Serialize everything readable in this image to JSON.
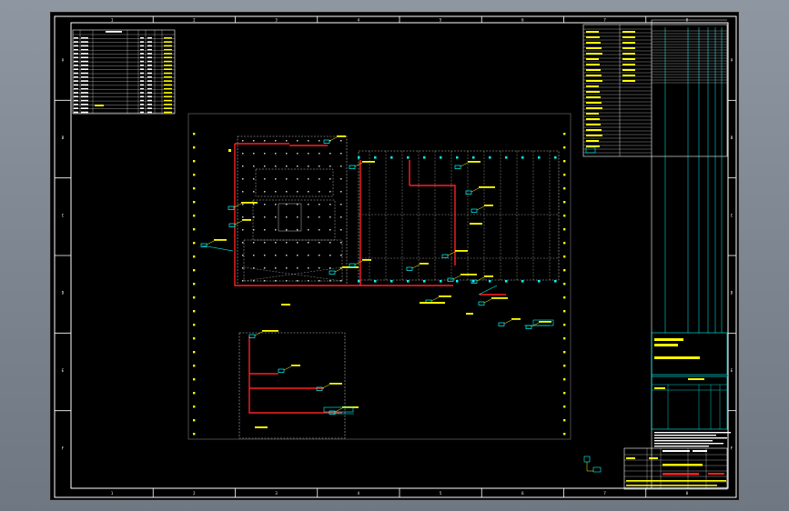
{
  "window": {
    "title": ""
  },
  "drawing": {
    "border_numbers_top": [
      "1",
      "2",
      "3",
      "4",
      "5",
      "6",
      "7",
      "8"
    ],
    "border_numbers_bottom": [
      "1",
      "2",
      "3",
      "4",
      "5",
      "6",
      "7",
      "8"
    ],
    "border_letters_left": [
      "A",
      "B",
      "C",
      "D",
      "E",
      "F"
    ],
    "border_letters_right": [
      "A",
      "B",
      "C",
      "D",
      "E",
      "F"
    ],
    "colors": {
      "background": "#000000",
      "frame": "#ffffff",
      "pipe": "#ff2020",
      "annotation": "#ffff00",
      "equipment": "#00ffff",
      "grid": "#a0a0a0"
    }
  }
}
